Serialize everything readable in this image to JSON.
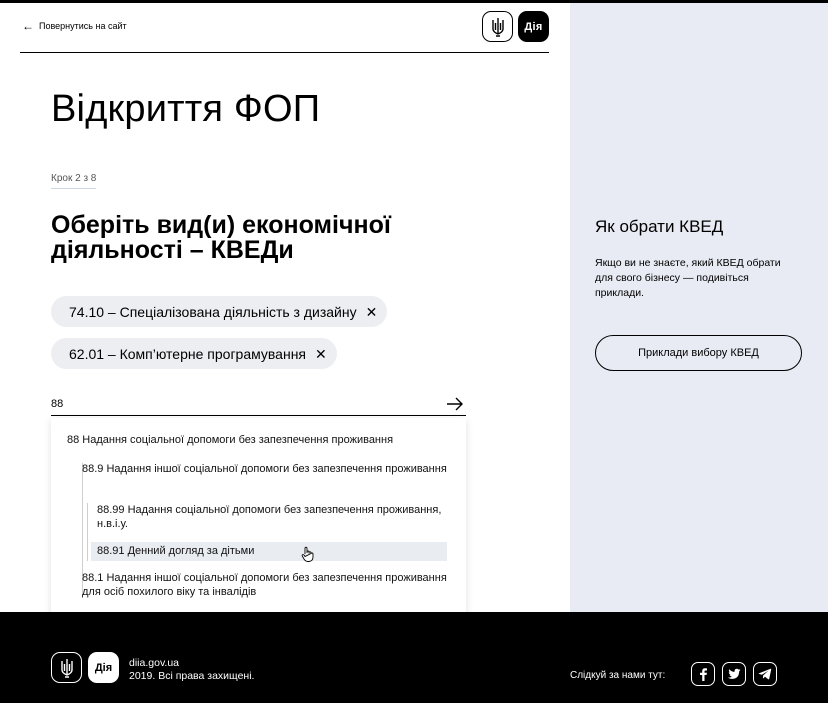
{
  "header": {
    "back_label": "Повернутись на сайт",
    "logo_diia": "Дія"
  },
  "main": {
    "title": "Відкриття ФОП",
    "step": "Крок 2 з 8",
    "question": "Оберіть вид(и) економічної діяльності – КВЕДи",
    "chips": [
      {
        "label": "74.10 – Спеціалізована діяльність з дизайну",
        "remove": "✕"
      },
      {
        "label": "62.01 – Комп’ютерне програмування",
        "remove": "✕"
      }
    ],
    "search": {
      "value": "88"
    },
    "dropdown": [
      {
        "label": "88 Надання соціальної допомоги без запезпечення проживання"
      },
      {
        "label": "88.9 Надання іншої соціальної допомоги без запезпечення проживання"
      },
      {
        "label": "88.99 Надання соціальної допомоги без запезпечення проживання, н.в.і.у."
      },
      {
        "label": "88.91 Денний догляд за дітьми",
        "highlighted": true
      },
      {
        "label": "88.1 Надання іншої соціальної допомоги без запезпечення проживання для осіб похилого віку та інвалідів"
      }
    ]
  },
  "aside": {
    "title": "Як обрати КВЕД",
    "text": "Якщо ви не знаєте, який КВЕД обрати для свого бізнесу — подивіться приклади.",
    "button": "Приклади вибору КВЕД"
  },
  "footer": {
    "logo_diia": "Дія",
    "site": "diia.gov.ua",
    "copyright": "2019. Всі права захищені.",
    "follow": "Слідкуй за нами тут:",
    "social_icons": [
      "facebook-icon",
      "twitter-icon",
      "telegram-icon"
    ]
  },
  "colors": {
    "aside_bg": "#e8ebf3",
    "chip_bg": "#eceef2",
    "highlight_bg": "#e9ecf1",
    "footer_bg": "#000000"
  }
}
